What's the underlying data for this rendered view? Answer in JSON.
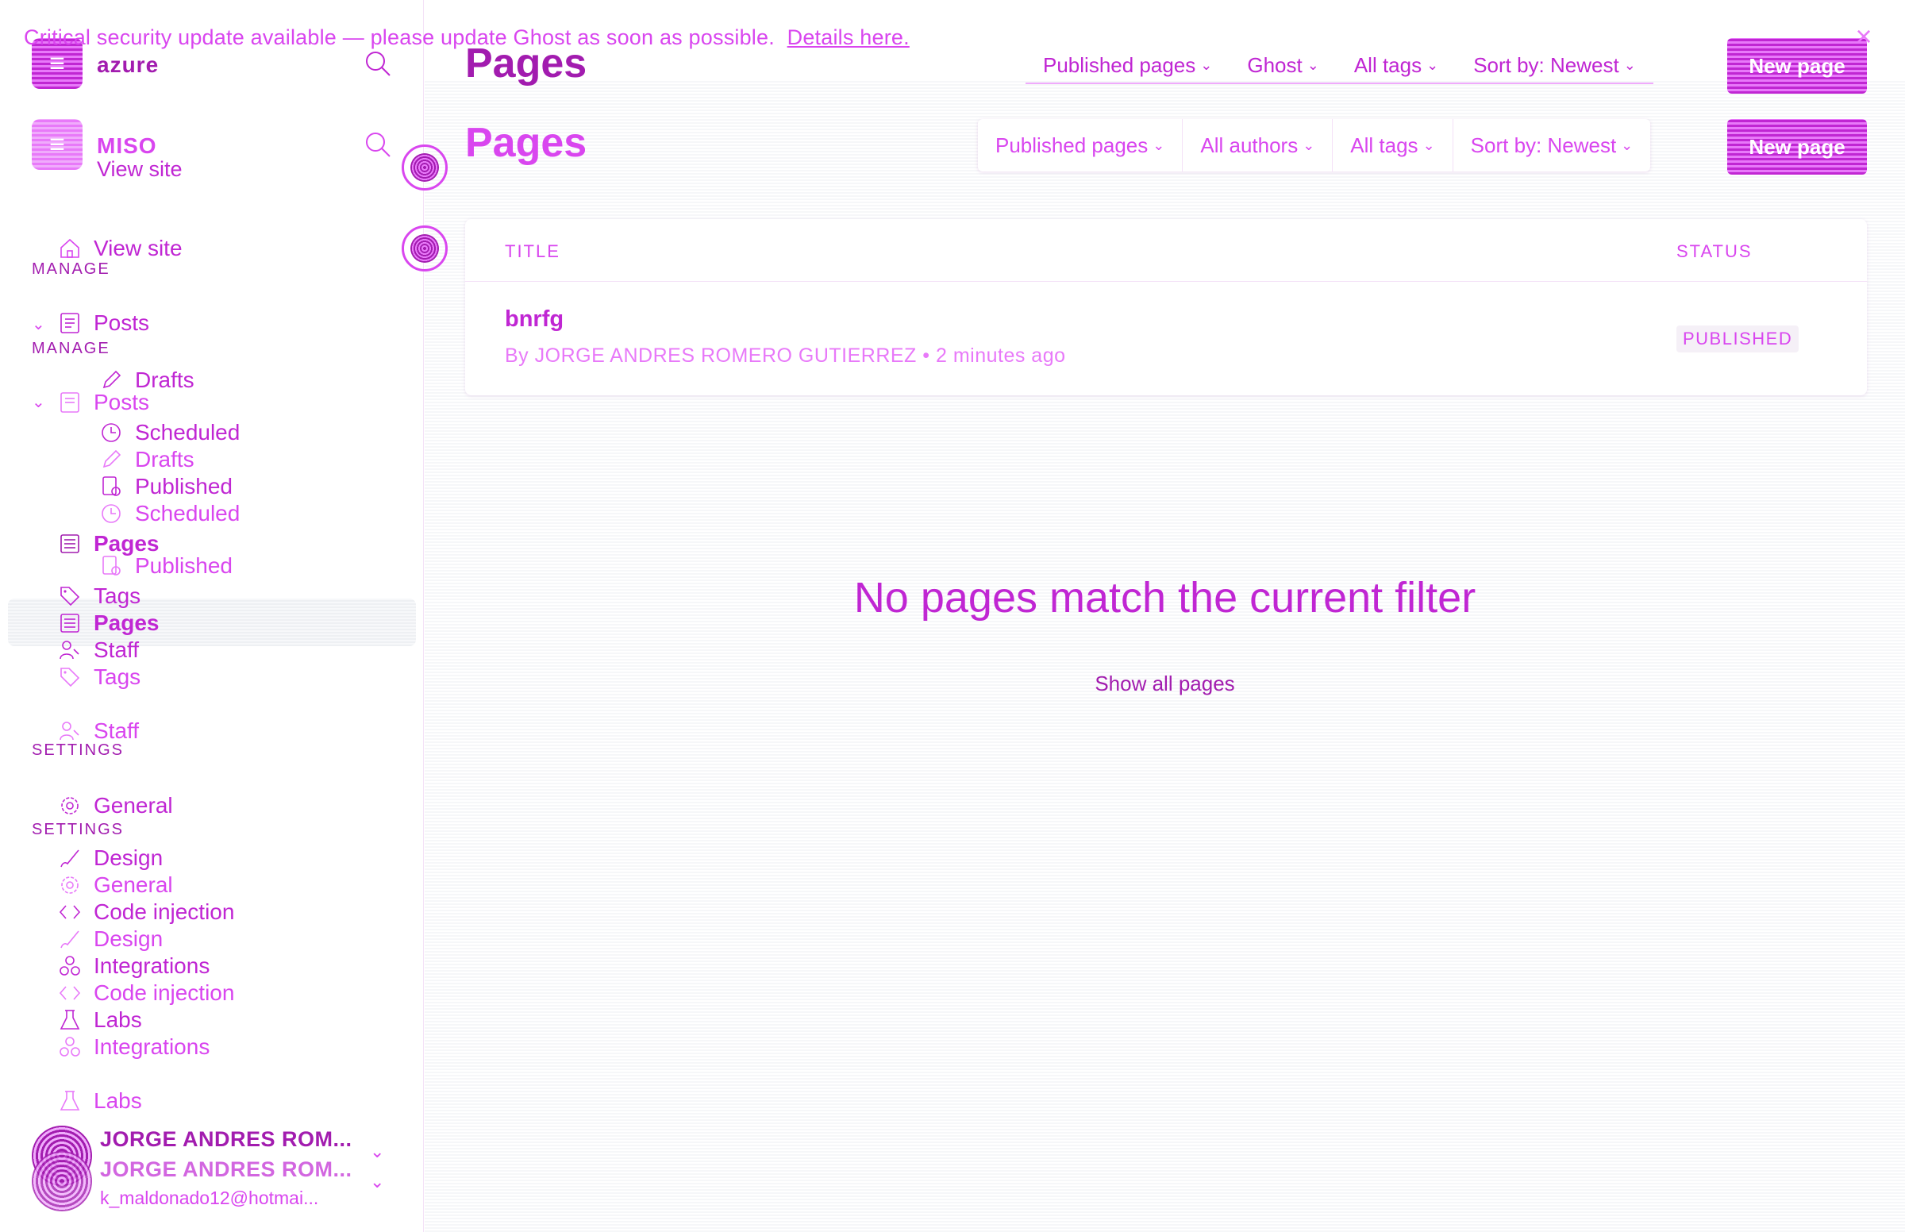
{
  "banner": {
    "text": "Critical security update available — please update Ghost as soon as possible.",
    "link": "Details here.",
    "close_icon": "close-icon"
  },
  "sidebar": {
    "site_primary": "azure",
    "site_secondary": "MISO",
    "view_site": "View site",
    "view_site_2": "View site",
    "manage_label": "MANAGE",
    "manage_label_2": "MANAGE",
    "settings_label": "SETTINGS",
    "settings_label_2": "SETTINGS",
    "items": {
      "posts": "Posts",
      "posts_2": "Posts",
      "drafts": "Drafts",
      "drafts_2": "Drafts",
      "scheduled": "Scheduled",
      "scheduled_2": "Scheduled",
      "published": "Published",
      "published_2": "Published",
      "pages": "Pages",
      "pages_2": "Pages",
      "tags": "Tags",
      "tags_2": "Tags",
      "staff": "Staff",
      "staff_2": "Staff",
      "general": "General",
      "general_2": "General",
      "design": "Design",
      "design_2": "Design",
      "code_injection": "Code injection",
      "code_injection_2": "Code injection",
      "integrations": "Integrations",
      "integrations_2": "Integrations",
      "labs": "Labs",
      "labs_2": "Labs"
    },
    "user": {
      "name": "JORGE ANDRES ROM...",
      "name_ghost": "JORGE ANDRES ROM...",
      "email": "k_maldonado12@hotmai..."
    }
  },
  "header": {
    "title": "Pages",
    "title_2": "Pages",
    "filters_back": [
      "Published pages",
      "Ghost",
      "All tags",
      "Sort by: Newest"
    ],
    "filters_front": [
      "Published pages",
      "All authors",
      "All tags",
      "Sort by: Newest"
    ],
    "new_button": "New page",
    "new_button_2": "New page"
  },
  "table": {
    "columns": [
      "TITLE",
      "STATUS"
    ],
    "rows": [
      {
        "title": "bnrfg",
        "meta": "By JORGE ANDRES ROMERO GUTIERREZ • 2 minutes ago",
        "status": "PUBLISHED"
      }
    ]
  },
  "empty_state": {
    "message": "No pages match the current filter",
    "action": "Show all pages"
  },
  "colors": {
    "accent": "#c026d3",
    "accent_light": "#d946ef",
    "background_tint": "#f6f7f9"
  }
}
